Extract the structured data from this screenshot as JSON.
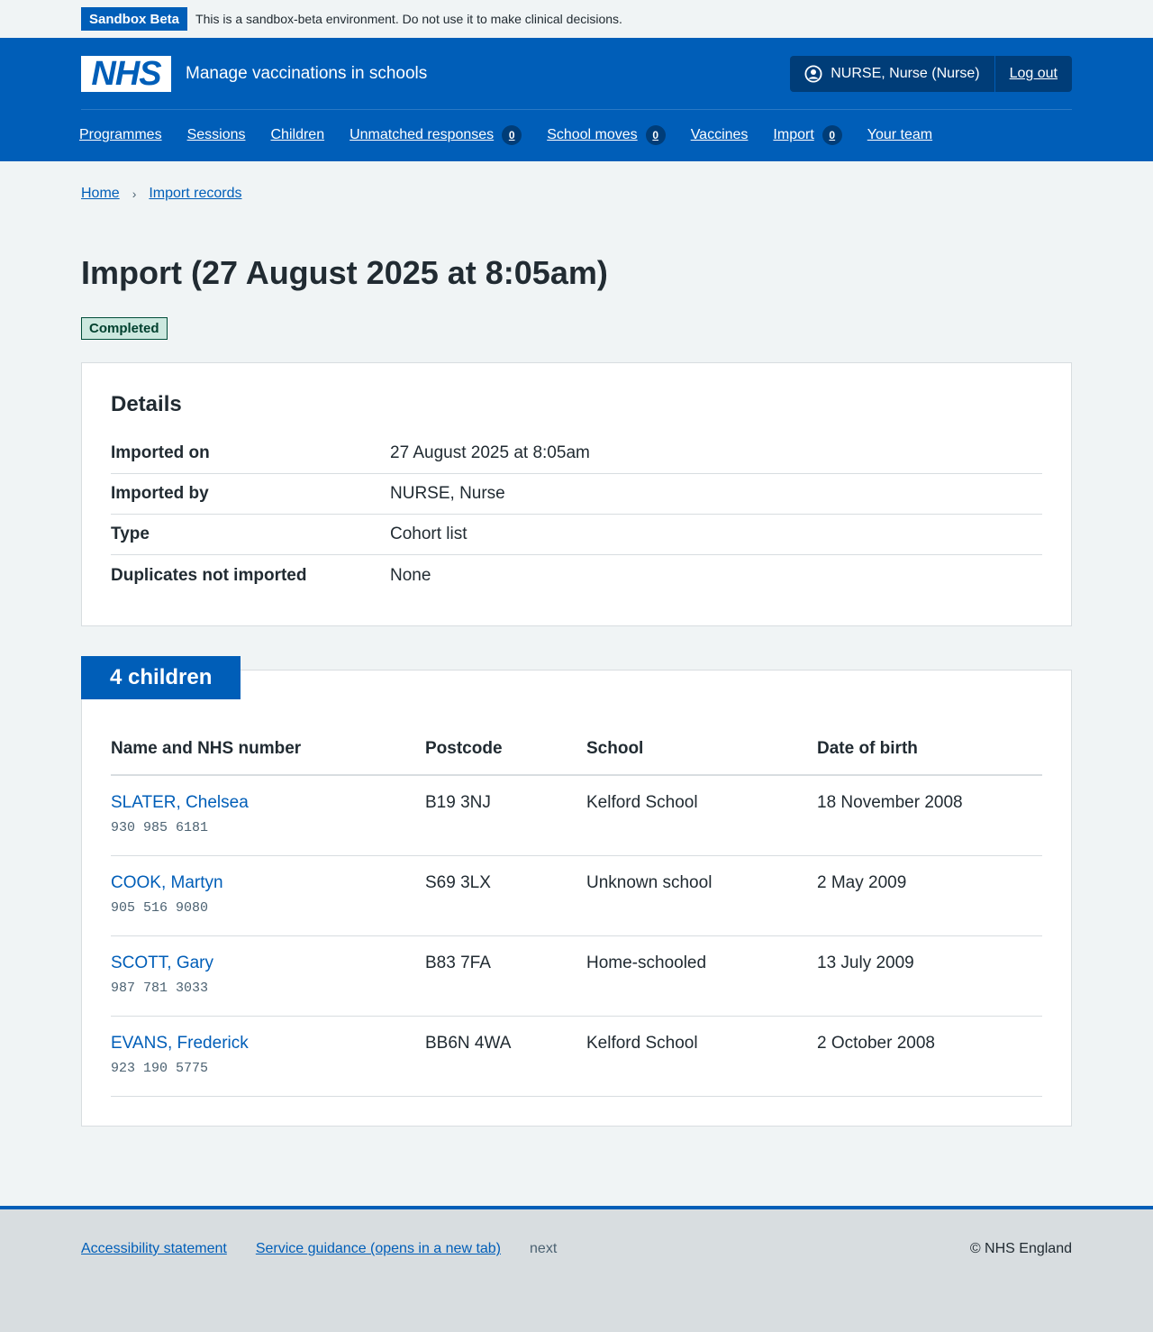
{
  "env_banner": {
    "tag": "Sandbox Beta",
    "text": "This is a sandbox-beta environment. Do not use it to make clinical decisions."
  },
  "header": {
    "logo": "NHS",
    "service_name": "Manage vaccinations in schools",
    "user": "NURSE, Nurse (Nurse)",
    "logout": "Log out"
  },
  "nav": [
    {
      "label": "Programmes"
    },
    {
      "label": "Sessions"
    },
    {
      "label": "Children"
    },
    {
      "label": "Unmatched responses",
      "count": "0"
    },
    {
      "label": "School moves",
      "count": "0"
    },
    {
      "label": "Vaccines"
    },
    {
      "label": "Import",
      "count": "0"
    },
    {
      "label": "Your team"
    }
  ],
  "breadcrumb": [
    "Home",
    "Import records"
  ],
  "page": {
    "title": "Import (27 August 2025 at 8:05am)",
    "status": "Completed"
  },
  "details": {
    "heading": "Details",
    "rows": [
      {
        "key": "Imported on",
        "value": "27 August 2025 at 8:05am"
      },
      {
        "key": "Imported by",
        "value": "NURSE, Nurse"
      },
      {
        "key": "Type",
        "value": "Cohort list"
      },
      {
        "key": "Duplicates not imported",
        "value": "None"
      }
    ]
  },
  "children": {
    "heading": "4 children",
    "columns": [
      "Name and NHS number",
      "Postcode",
      "School",
      "Date of birth"
    ],
    "rows": [
      {
        "name": "SLATER, Chelsea",
        "nhs": "930 985 6181",
        "postcode": "B19 3NJ",
        "school": "Kelford School",
        "dob": "18 November 2008"
      },
      {
        "name": "COOK, Martyn",
        "nhs": "905 516 9080",
        "postcode": "S69 3LX",
        "school": "Unknown school",
        "dob": "2 May 2009"
      },
      {
        "name": "SCOTT, Gary",
        "nhs": "987 781 3033",
        "postcode": "B83 7FA",
        "school": "Home-schooled",
        "dob": "13 July 2009"
      },
      {
        "name": "EVANS, Frederick",
        "nhs": "923 190 5775",
        "postcode": "BB6N 4WA",
        "school": "Kelford School",
        "dob": "2 October 2008"
      }
    ]
  },
  "footer": {
    "links": [
      "Accessibility statement",
      "Service guidance (opens in a new tab)"
    ],
    "version": "next",
    "copyright": "© NHS England"
  }
}
